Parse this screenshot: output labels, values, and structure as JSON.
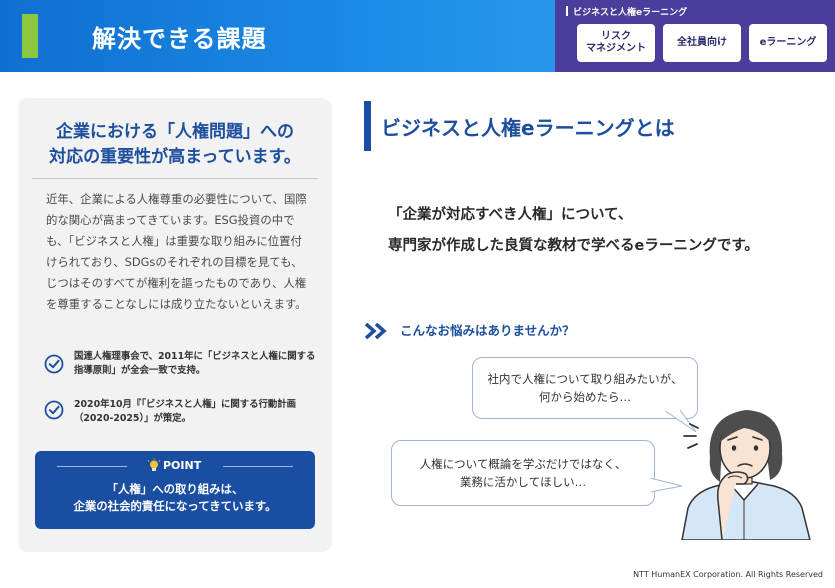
{
  "header": {
    "title": "解決できる課題",
    "accent_color": "#8cc63f"
  },
  "categories": {
    "title": "ビジネスと人権eラーニング",
    "buttons": [
      "リスク\nマネジメント",
      "全社員向け",
      "eラーニング"
    ]
  },
  "left_card": {
    "heading": "企業における「人権問題」への\n対応の重要性が高まっています。",
    "body": "近年、企業による人権尊重の必要性について、国際的な関心が高まってきています。ESG投資の中でも、「ビジネスと人権」は重要な取り組みに位置付けられており、SDGsのそれぞれの目標を見ても、じつはそのすべてが権利を謳ったものであり、人権を尊重することなしには成り立たないといえます。",
    "checks": [
      "国連人権理事会で、2011年に「ビジネスと人権に関する指導原則」が全会一致で支持。",
      "2020年10月『「ビジネスと人権」に関する行動計画（2020-2025）」が策定。"
    ],
    "point": {
      "label": "POINT",
      "text": "「人権」への取り組みは、\n企業の社会的責任になってきています。"
    }
  },
  "right": {
    "title": "ビジネスと人権eラーニングとは",
    "lead": "「企業が対応すべき人権」について、\n専門家が作成した良質な教材で学べるeラーニングです。",
    "concern_title": "こんなお悩みはありませんか？",
    "bubbles": [
      "社内で人権について取り組みたいが、\n何から始めたら…",
      "人権について概論を学ぶだけではなく、\n業務に活かしてほしい…"
    ]
  },
  "footer": "NTT HumanEX Corporation. All Rights Reserved",
  "colors": {
    "brand_blue": "#1d4f9e",
    "header_blue": "#1c8ce6",
    "category_purple": "#4a3d9c"
  }
}
